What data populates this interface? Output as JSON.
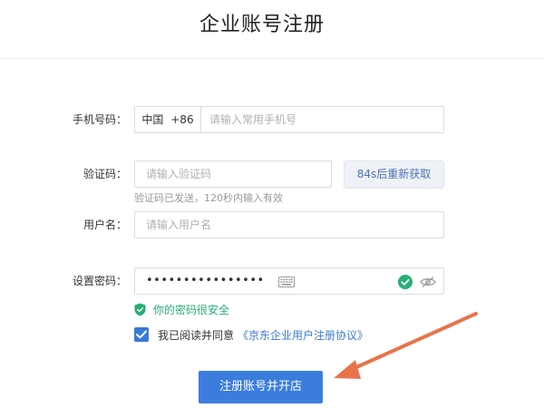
{
  "page": {
    "title": "企业账号注册"
  },
  "form": {
    "phone": {
      "label": "手机号码：",
      "country": "中国",
      "code": "+86",
      "placeholder": "请输入常用手机号"
    },
    "captcha": {
      "label": "验证码：",
      "placeholder": "请输入验证码",
      "resend_label": "84s后重新获取",
      "hint": "验证码已发送，120秒内输入有效"
    },
    "username": {
      "label": "用户名：",
      "placeholder": "请输入用户名"
    },
    "password": {
      "label": "设置密码：",
      "value_masked": "••••••••••••••••",
      "strength_text": "你的密码很安全"
    },
    "agreement": {
      "checked": true,
      "text": "我已阅读并同意",
      "link": "《京东企业用户注册协议》"
    },
    "submit_label": "注册账号并开店"
  },
  "icons": {
    "keyboard": "keyboard-icon",
    "check": "check-circle-icon",
    "eye": "eye-hidden-icon",
    "shield": "shield-icon",
    "checkbox": "checkmark-icon"
  },
  "colors": {
    "primary": "#3b7ddd",
    "success": "#27ae74",
    "annotation_arrow": "#e8734a"
  }
}
